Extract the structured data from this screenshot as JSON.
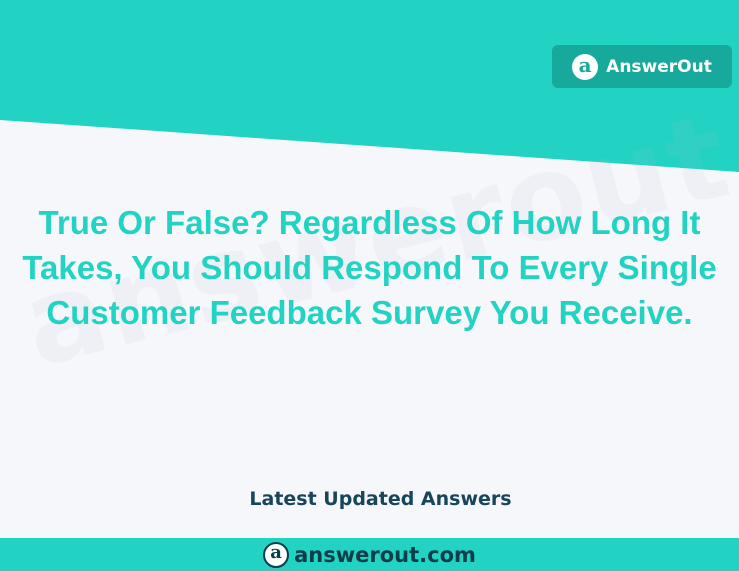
{
  "brand": {
    "logo_glyph": "a",
    "name": "AnswerOut",
    "badge_color": "#17a99c"
  },
  "watermark": {
    "text": "answerout.com"
  },
  "question": {
    "text": "True Or False? Regardless Of How Long It Takes, You Should Respond To Every Single Customer Feedback Survey You Receive.",
    "color": "#22d3c3"
  },
  "footer": {
    "heading": "Latest Updated Answers",
    "heading_color": "#17455a",
    "logo_glyph": "a",
    "url": "answerout.com",
    "url_color": "#0b3d4a",
    "bar_color": "#22d3c3"
  },
  "colors": {
    "accent": "#22d3c3",
    "background": "#f6f7fa"
  }
}
